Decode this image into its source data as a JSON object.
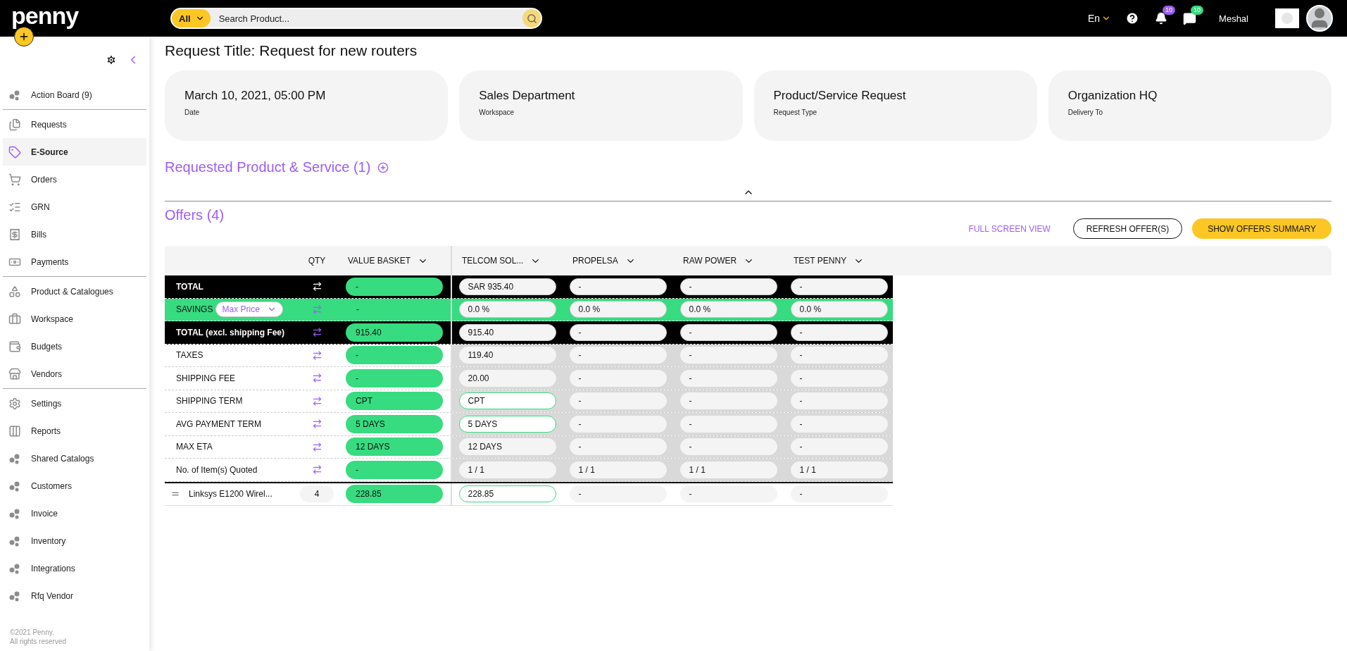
{
  "top_bar": {
    "logo": "penny",
    "search": {
      "scope": "All",
      "placeholder": "Search Product..."
    },
    "language": "En",
    "notifications_badge": "10",
    "messages_badge": "10",
    "user_name": "Meshal"
  },
  "sidebar": {
    "groups": [
      {
        "items": [
          {
            "label": "Action Board (9)",
            "selected": false
          }
        ]
      },
      {
        "items": [
          {
            "label": "Requests",
            "selected": false
          },
          {
            "label": "E-Source",
            "selected": true
          },
          {
            "label": "Orders",
            "selected": false
          },
          {
            "label": "GRN",
            "selected": false
          },
          {
            "label": "Bills",
            "selected": false
          },
          {
            "label": "Payments",
            "selected": false
          }
        ]
      },
      {
        "items": [
          {
            "label": "Product & Catalogues",
            "selected": false
          },
          {
            "label": "Workspace",
            "selected": false
          },
          {
            "label": "Budgets",
            "selected": false
          },
          {
            "label": "Vendors",
            "selected": false
          }
        ]
      },
      {
        "items": [
          {
            "label": "Settings",
            "selected": false
          },
          {
            "label": "Reports",
            "selected": false
          },
          {
            "label": "Shared Catalogs",
            "selected": false
          },
          {
            "label": "Customers",
            "selected": false
          },
          {
            "label": "Invoice",
            "selected": false
          },
          {
            "label": "Inventory",
            "selected": false
          },
          {
            "label": "Integrations",
            "selected": false
          },
          {
            "label": "Rfq Vendor",
            "selected": false
          }
        ]
      }
    ],
    "footer": [
      "©2021 Penny.",
      "All rights reserved"
    ]
  },
  "request_title": "Request Title: Request for new routers",
  "info_cards": [
    {
      "value": "March 10, 2021, 05:00 PM",
      "label": "Date"
    },
    {
      "value": "Sales Department",
      "label": "Workspace"
    },
    {
      "value": "Product/Service Request",
      "label": "Request Type"
    },
    {
      "value": "Organization HQ",
      "label": "Delivery To"
    }
  ],
  "requested_section": {
    "title": "Requested Product & Service (1)"
  },
  "offers": {
    "title": "Offers (4)",
    "actions": [
      {
        "label": "FULL SCREEN VIEW",
        "kind": "link"
      },
      {
        "label": "REFRESH OFFER(S)",
        "kind": "outline"
      },
      {
        "label": "SHOW OFFERS SUMMARY",
        "kind": "primary"
      }
    ],
    "columns": {
      "qty": "QTY",
      "basket": "VALUE BASKET",
      "suppliers": [
        "TELCOM SOL...",
        "PROPELSA",
        "RAW POWER",
        "TEST PENNY"
      ]
    },
    "rows": [
      {
        "kind": "grand_total",
        "label": "TOTAL",
        "basket": "-",
        "suppliers": [
          {
            "value": "SAR 935.40",
            "highlighted": false
          },
          {
            "value": "-",
            "highlighted": false
          },
          {
            "value": "-",
            "highlighted": false
          },
          {
            "value": "-",
            "highlighted": false
          }
        ]
      },
      {
        "kind": "savings",
        "label": "SAVINGS",
        "select": "Max Price",
        "basket": "-",
        "suppliers": [
          {
            "value": "0.0 %",
            "highlighted": false
          },
          {
            "value": "0.0 %",
            "highlighted": false
          },
          {
            "value": "0.0 %",
            "highlighted": false
          },
          {
            "value": "0.0 %",
            "highlighted": false
          }
        ]
      },
      {
        "kind": "total",
        "label": "TOTAL (excl. shipping Fee)",
        "basket": "915.40",
        "suppliers": [
          {
            "value": "915.40",
            "highlighted": false
          },
          {
            "value": "-",
            "highlighted": false
          },
          {
            "value": "-",
            "highlighted": false
          },
          {
            "value": "-",
            "highlighted": false
          }
        ]
      },
      {
        "kind": "detail",
        "label": "TAXES",
        "basket": "-",
        "suppliers": [
          {
            "value": "119.40",
            "highlighted": false
          },
          {
            "value": "-",
            "highlighted": false
          },
          {
            "value": "-",
            "highlighted": false
          },
          {
            "value": "-",
            "highlighted": false
          }
        ]
      },
      {
        "kind": "detail",
        "label": "SHIPPING FEE",
        "basket": "-",
        "suppliers": [
          {
            "value": "20.00",
            "highlighted": false
          },
          {
            "value": "-",
            "highlighted": false
          },
          {
            "value": "-",
            "highlighted": false
          },
          {
            "value": "-",
            "highlighted": false
          }
        ]
      },
      {
        "kind": "detail",
        "label": "SHIPPING TERM",
        "basket": "CPT",
        "suppliers": [
          {
            "value": "CPT",
            "highlighted": true
          },
          {
            "value": "-",
            "highlighted": false
          },
          {
            "value": "-",
            "highlighted": false
          },
          {
            "value": "-",
            "highlighted": false
          }
        ]
      },
      {
        "kind": "detail",
        "label": "AVG PAYMENT TERM",
        "basket": "5 DAYS",
        "suppliers": [
          {
            "value": "5 DAYS",
            "highlighted": true
          },
          {
            "value": "-",
            "highlighted": false
          },
          {
            "value": "-",
            "highlighted": false
          },
          {
            "value": "-",
            "highlighted": false
          }
        ]
      },
      {
        "kind": "detail",
        "label": "MAX ETA",
        "basket": "12 DAYS",
        "suppliers": [
          {
            "value": "12 DAYS",
            "highlighted": false
          },
          {
            "value": "-",
            "highlighted": false
          },
          {
            "value": "-",
            "highlighted": false
          },
          {
            "value": "-",
            "highlighted": false
          }
        ]
      },
      {
        "kind": "detail",
        "label": "No. of Item(s) Quoted",
        "basket": "-",
        "suppliers": [
          {
            "value": "1 / 1",
            "highlighted": false
          },
          {
            "value": "1 / 1",
            "highlighted": false
          },
          {
            "value": "1 / 1",
            "highlighted": false
          },
          {
            "value": "1 / 1",
            "highlighted": false
          }
        ]
      }
    ],
    "items": [
      {
        "name": "Linksys E1200 Wirel...",
        "qty": "4",
        "basket": "228.85",
        "suppliers": [
          {
            "value": "228.85",
            "highlighted": true
          },
          {
            "value": "-",
            "highlighted": false
          },
          {
            "value": "-",
            "highlighted": false
          },
          {
            "value": "-",
            "highlighted": false
          }
        ]
      }
    ]
  }
}
